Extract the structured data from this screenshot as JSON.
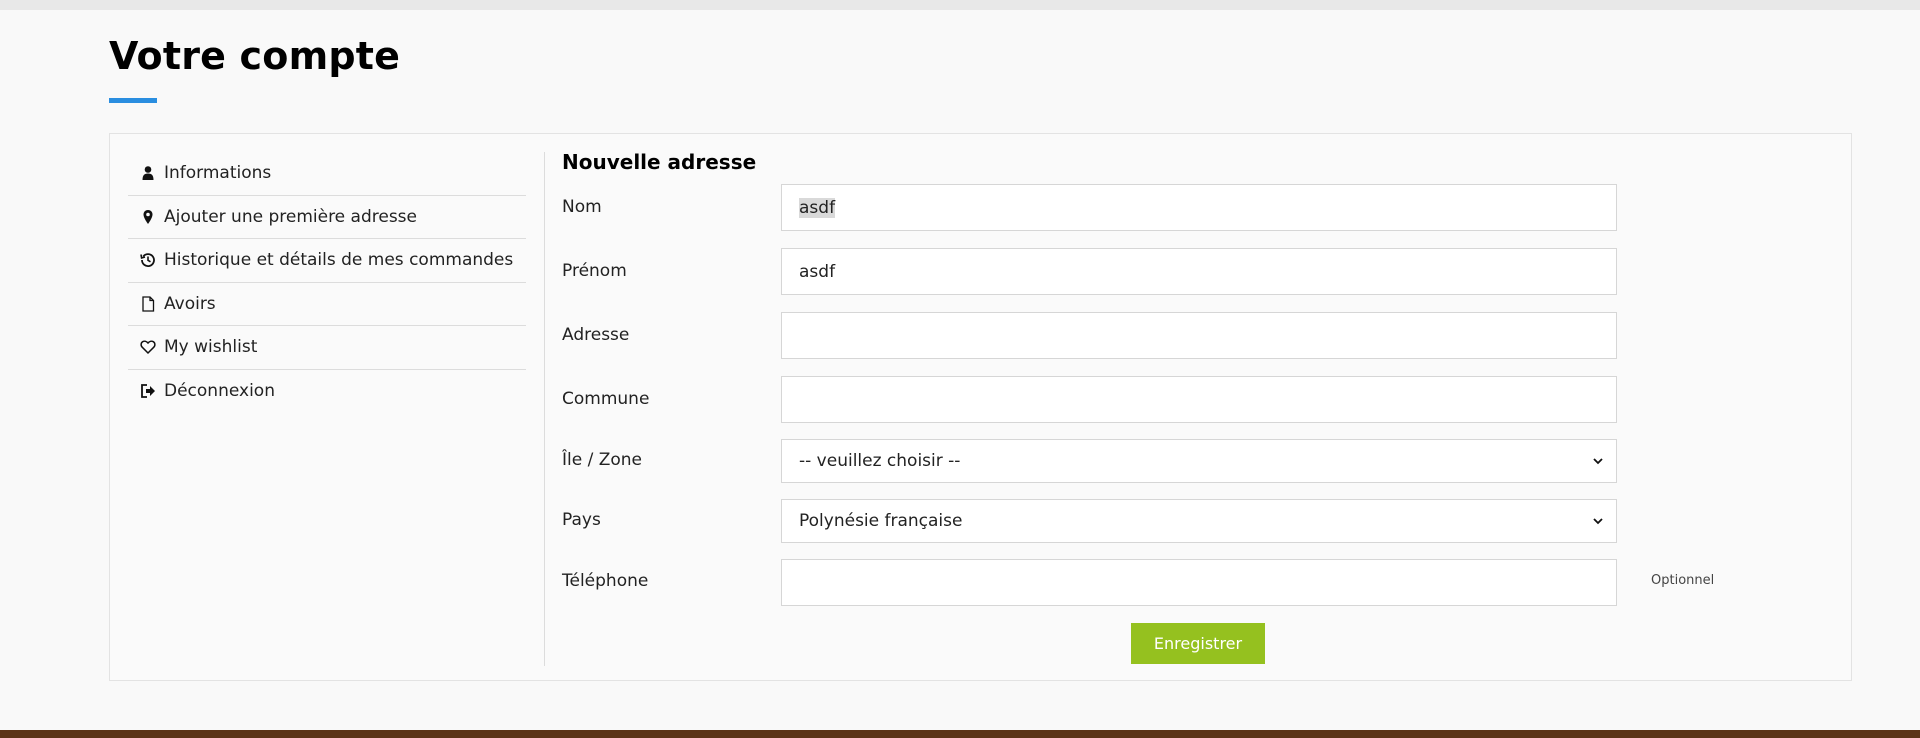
{
  "page": {
    "title": "Votre compte"
  },
  "sidebar": {
    "items": [
      {
        "label": "Informations",
        "icon": "user-icon"
      },
      {
        "label": "Ajouter une première adresse",
        "icon": "map-pin-icon"
      },
      {
        "label": "Historique et détails de mes commandes",
        "icon": "history-icon"
      },
      {
        "label": "Avoirs",
        "icon": "document-icon"
      },
      {
        "label": "My wishlist",
        "icon": "heart-icon"
      },
      {
        "label": "Déconnexion",
        "icon": "sign-out-icon"
      }
    ]
  },
  "form": {
    "title": "Nouvelle adresse",
    "fields": {
      "nom": {
        "label": "Nom",
        "value": "asdf"
      },
      "prenom": {
        "label": "Prénom",
        "value": "asdf"
      },
      "adresse": {
        "label": "Adresse",
        "value": ""
      },
      "commune": {
        "label": "Commune",
        "value": ""
      },
      "zone": {
        "label": "Île / Zone",
        "value": "-- veuillez choisir --"
      },
      "pays": {
        "label": "Pays",
        "value": "Polynésie française"
      },
      "telephone": {
        "label": "Téléphone",
        "value": "",
        "hint": "Optionnel"
      }
    },
    "save_label": "Enregistrer"
  },
  "colors": {
    "accent_blue": "#2a8ee0",
    "button_green": "#95c11f",
    "footer_brown": "#5c3317"
  }
}
